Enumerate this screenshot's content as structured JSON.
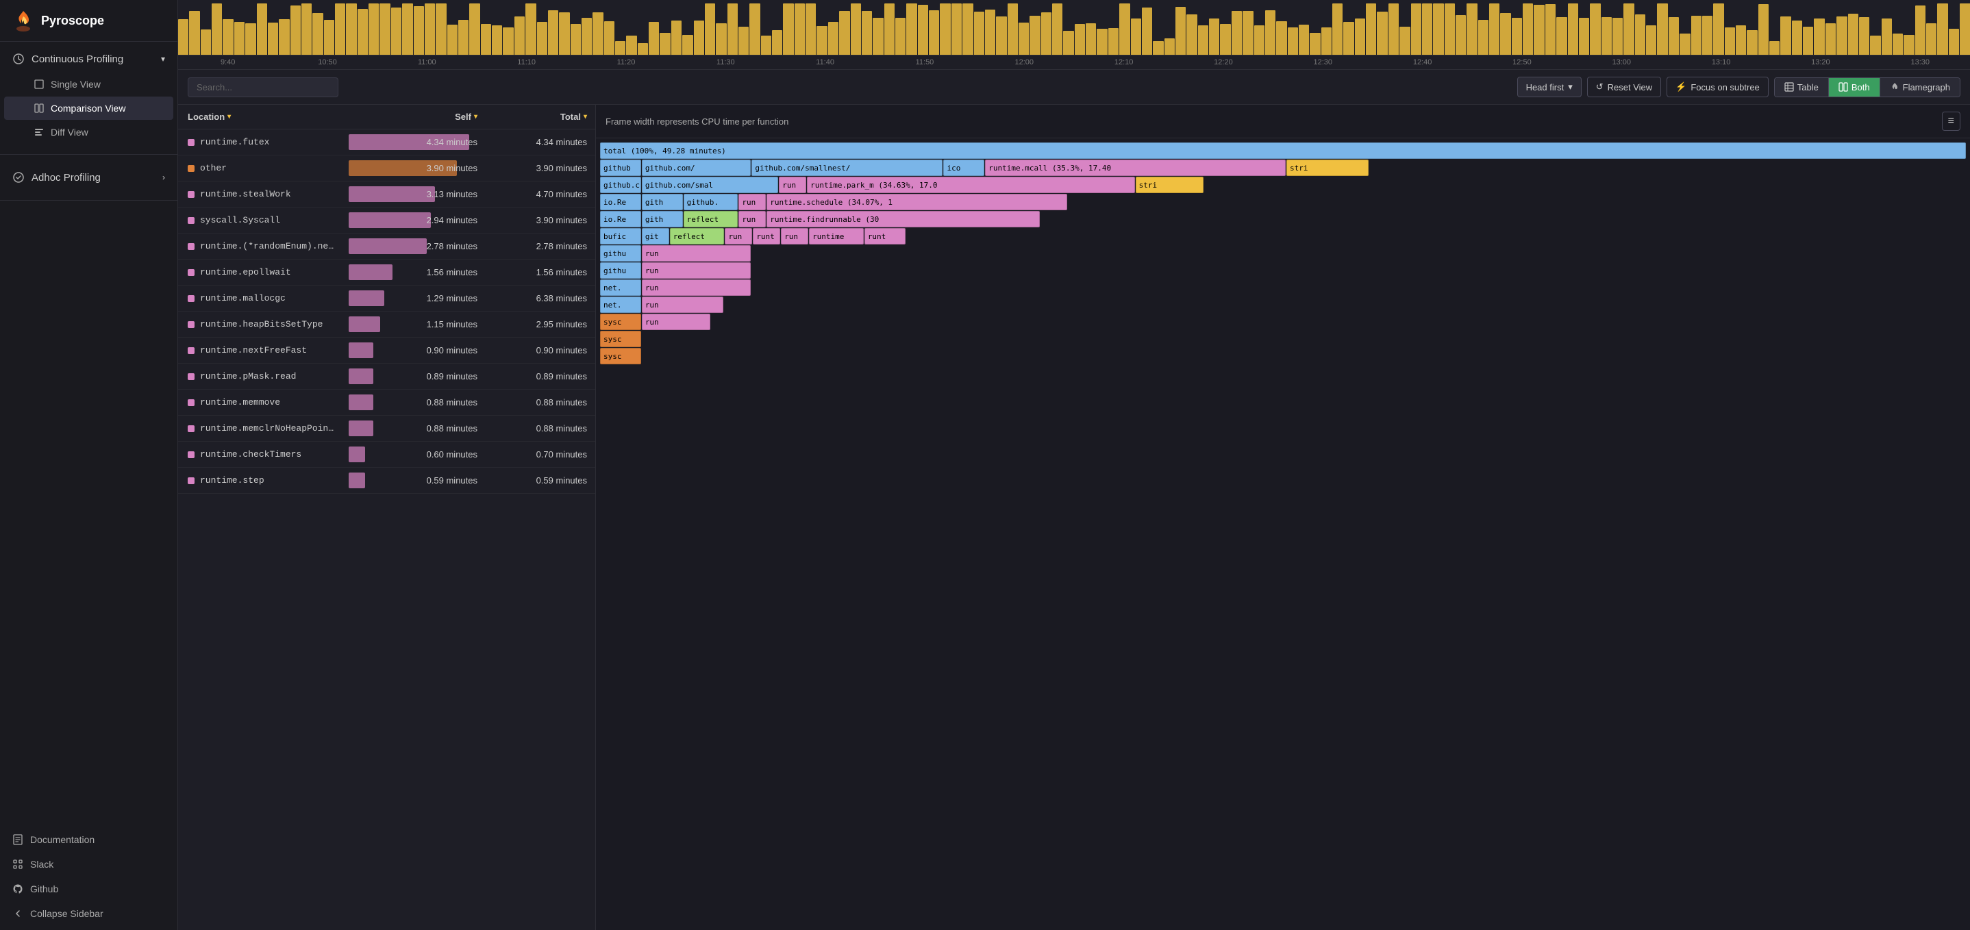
{
  "app": {
    "title": "Pyroscope"
  },
  "sidebar": {
    "continuous_profiling_label": "Continuous Profiling",
    "single_view_label": "Single View",
    "comparison_view_label": "Comparison View",
    "diff_view_label": "Diff View",
    "adhoc_profiling_label": "Adhoc Profiling",
    "documentation_label": "Documentation",
    "slack_label": "Slack",
    "github_label": "Github",
    "collapse_label": "Collapse Sidebar"
  },
  "toolbar": {
    "search_placeholder": "Search...",
    "head_first_label": "Head first",
    "reset_view_label": "Reset View",
    "focus_subtree_label": "Focus on subtree",
    "table_label": "Table",
    "both_label": "Both",
    "flamegraph_label": "Flamegraph",
    "active_view": "both"
  },
  "timeline": {
    "labels": [
      "9:40",
      "10:50",
      "11:00",
      "11:10",
      "11:20",
      "11:30",
      "11:40",
      "11:50",
      "12:00",
      "12:10",
      "12:20",
      "12:30",
      "12:40",
      "12:50",
      "13:00",
      "13:10",
      "13:20",
      "13:30"
    ]
  },
  "table": {
    "col_location": "Location",
    "col_self": "Self",
    "col_total": "Total",
    "rows": [
      {
        "name": "runtime.futex",
        "color": "#d884c4",
        "self": "4.34 minutes",
        "total": "4.34 minutes",
        "self_pct": 88
      },
      {
        "name": "other",
        "color": "#e0823a",
        "self": "3.90 minutes",
        "total": "3.90 minutes",
        "self_pct": 79
      },
      {
        "name": "runtime.stealWork",
        "color": "#d884c4",
        "self": "3.13 minutes",
        "total": "4.70 minutes",
        "self_pct": 63
      },
      {
        "name": "syscall.Syscall",
        "color": "#d884c4",
        "self": "2.94 minutes",
        "total": "3.90 minutes",
        "self_pct": 60
      },
      {
        "name": "runtime.(*randomEnum).ne…",
        "color": "#d884c4",
        "self": "2.78 minutes",
        "total": "2.78 minutes",
        "self_pct": 57
      },
      {
        "name": "runtime.epollwait",
        "color": "#d884c4",
        "self": "1.56 minutes",
        "total": "1.56 minutes",
        "self_pct": 32
      },
      {
        "name": "runtime.mallocgc",
        "color": "#d884c4",
        "self": "1.29 minutes",
        "total": "6.38 minutes",
        "self_pct": 26
      },
      {
        "name": "runtime.heapBitsSetType",
        "color": "#d884c4",
        "self": "1.15 minutes",
        "total": "2.95 minutes",
        "self_pct": 23
      },
      {
        "name": "runtime.nextFreeFast",
        "color": "#d884c4",
        "self": "0.90 minutes",
        "total": "0.90 minutes",
        "self_pct": 18
      },
      {
        "name": "runtime.pMask.read",
        "color": "#d884c4",
        "self": "0.89 minutes",
        "total": "0.89 minutes",
        "self_pct": 18
      },
      {
        "name": "runtime.memmove",
        "color": "#d884c4",
        "self": "0.88 minutes",
        "total": "0.88 minutes",
        "self_pct": 18
      },
      {
        "name": "runtime.memclrNoHeapPoin…",
        "color": "#d884c4",
        "self": "0.88 minutes",
        "total": "0.88 minutes",
        "self_pct": 18
      },
      {
        "name": "runtime.checkTimers",
        "color": "#d884c4",
        "self": "0.60 minutes",
        "total": "0.70 minutes",
        "self_pct": 12
      },
      {
        "name": "runtime.step",
        "color": "#d884c4",
        "self": "0.59 minutes",
        "total": "0.59 minutes",
        "self_pct": 12
      }
    ]
  },
  "flamegraph": {
    "title": "Frame width represents CPU time per function",
    "total_label": "total (100%, 49.28 minutes)",
    "rows": [
      [
        {
          "label": "total (100%, 49.28 minutes)",
          "color": "#7ab5e8",
          "width_pct": 100
        }
      ],
      [
        {
          "label": "github",
          "color": "#7ab5e8",
          "width_pct": 3
        },
        {
          "label": "github.com/",
          "color": "#7ab5e8",
          "width_pct": 8
        },
        {
          "label": "github.com/smallnest/",
          "color": "#7ab5e8",
          "width_pct": 14
        },
        {
          "label": "ico",
          "color": "#7ab5e8",
          "width_pct": 3
        },
        {
          "label": "runtime.mcall (35.3%, 17.40",
          "color": "#d884c4",
          "width_pct": 22
        },
        {
          "label": "stri",
          "color": "#f0c040",
          "width_pct": 6
        }
      ],
      [
        {
          "label": "github.c",
          "color": "#7ab5e8",
          "width_pct": 3
        },
        {
          "label": "github.com/smal",
          "color": "#7ab5e8",
          "width_pct": 10
        },
        {
          "label": "run",
          "color": "#d884c4",
          "width_pct": 2
        },
        {
          "label": "runtime.park_m (34.63%, 17.0",
          "color": "#d884c4",
          "width_pct": 24
        },
        {
          "label": "stri",
          "color": "#f0c040",
          "width_pct": 5
        }
      ],
      [
        {
          "label": "io.Re",
          "color": "#7ab5e8",
          "width_pct": 3
        },
        {
          "label": "gith",
          "color": "#7ab5e8",
          "width_pct": 3
        },
        {
          "label": "github.",
          "color": "#7ab5e8",
          "width_pct": 4
        },
        {
          "label": "run",
          "color": "#d884c4",
          "width_pct": 2
        },
        {
          "label": "runtime.schedule (34.07%, 1",
          "color": "#d884c4",
          "width_pct": 22
        }
      ],
      [
        {
          "label": "io.Re",
          "color": "#7ab5e8",
          "width_pct": 3
        },
        {
          "label": "gith",
          "color": "#7ab5e8",
          "width_pct": 3
        },
        {
          "label": "reflect",
          "color": "#a0d878",
          "width_pct": 4
        },
        {
          "label": "run",
          "color": "#d884c4",
          "width_pct": 2
        },
        {
          "label": "runtime.findrunnable (30",
          "color": "#d884c4",
          "width_pct": 20
        }
      ],
      [
        {
          "label": "bufic",
          "color": "#7ab5e8",
          "width_pct": 3
        },
        {
          "label": "git",
          "color": "#7ab5e8",
          "width_pct": 2
        },
        {
          "label": "reflect",
          "color": "#a0d878",
          "width_pct": 4
        },
        {
          "label": "run",
          "color": "#d884c4",
          "width_pct": 2
        },
        {
          "label": "runt",
          "color": "#d884c4",
          "width_pct": 2
        },
        {
          "label": "run",
          "color": "#d884c4",
          "width_pct": 2
        },
        {
          "label": "runtime",
          "color": "#d884c4",
          "width_pct": 4
        },
        {
          "label": "runt",
          "color": "#d884c4",
          "width_pct": 3
        }
      ],
      [
        {
          "label": "githu",
          "color": "#7ab5e8",
          "width_pct": 3
        },
        {
          "label": "run",
          "color": "#d884c4",
          "width_pct": 8
        }
      ],
      [
        {
          "label": "githu",
          "color": "#7ab5e8",
          "width_pct": 3
        },
        {
          "label": "run",
          "color": "#d884c4",
          "width_pct": 8
        }
      ],
      [
        {
          "label": "net.",
          "color": "#7ab5e8",
          "width_pct": 3
        },
        {
          "label": "run",
          "color": "#d884c4",
          "width_pct": 8
        }
      ],
      [
        {
          "label": "net.",
          "color": "#7ab5e8",
          "width_pct": 3
        },
        {
          "label": "run",
          "color": "#d884c4",
          "width_pct": 6
        }
      ],
      [
        {
          "label": "sysc",
          "color": "#e0823a",
          "width_pct": 3
        },
        {
          "label": "run",
          "color": "#d884c4",
          "width_pct": 5
        }
      ],
      [
        {
          "label": "sysc",
          "color": "#e0823a",
          "width_pct": 3
        }
      ],
      [
        {
          "label": "sysc",
          "color": "#e0823a",
          "width_pct": 3
        }
      ]
    ]
  }
}
